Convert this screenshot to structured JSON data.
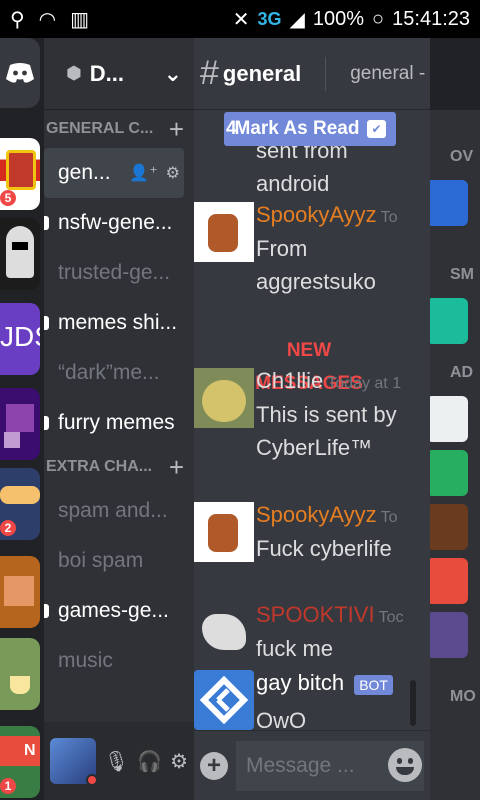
{
  "status_bar": {
    "network": "3G",
    "battery": "100%",
    "time": "15:41:23"
  },
  "server": {
    "name": "D..."
  },
  "channels": [
    {
      "type": "category",
      "label": "GENERAL C..."
    },
    {
      "type": "channel",
      "label": "gen...",
      "state": "selected"
    },
    {
      "type": "channel",
      "label": "nsfw-gene...",
      "state": "unread"
    },
    {
      "type": "channel",
      "label": "trusted-ge...",
      "state": "read"
    },
    {
      "type": "channel",
      "label": "memes shi...",
      "state": "unread"
    },
    {
      "type": "channel",
      "label": "“dark”me...",
      "state": "read"
    },
    {
      "type": "channel",
      "label": "furry memes",
      "state": "unread"
    },
    {
      "type": "category",
      "label": "EXTRA CHA..."
    },
    {
      "type": "channel",
      "label": "spam and...",
      "state": "read"
    },
    {
      "type": "channel",
      "label": "boi spam",
      "state": "read"
    },
    {
      "type": "channel",
      "label": "games-ge...",
      "state": "unread"
    },
    {
      "type": "channel",
      "label": "music",
      "state": "read"
    }
  ],
  "guild_badges": [
    "5",
    "2",
    "1"
  ],
  "chat": {
    "channel_name": "general",
    "topic": "general - SF...",
    "mark_as_read": "Mark As Read",
    "mark_prefix": "4",
    "new_messages": "NEW MESSAGES",
    "composer_placeholder": "Message ...",
    "messages": [
      {
        "author": "",
        "time": "",
        "body": "sent from android",
        "color": "#dcddde"
      },
      {
        "author": "SpookyAyyz",
        "time": "To",
        "body": "From aggrestsuko",
        "color": "#e67e22"
      },
      {
        "author": "Ch1llie",
        "time": "Today at 1",
        "body": "This is sent by CyberLife™",
        "color": "#dcddde"
      },
      {
        "author": "SpookyAyyz",
        "time": "To",
        "body": "Fuck cyberlife",
        "color": "#e67e22"
      },
      {
        "author": "SPOOKTIVI",
        "time": "Toc",
        "body": "fuck me",
        "color": "#c0392b"
      },
      {
        "author": "gay bitch",
        "time": "",
        "bot_tag": "BOT",
        "body": "OwO",
        "color": "#ffffff"
      }
    ]
  },
  "member_categories": [
    "OV",
    "SM",
    "AD",
    "MO"
  ],
  "colors": {
    "accent": "#7289da",
    "unread_red": "#f04747",
    "orange_author": "#e67e22"
  }
}
